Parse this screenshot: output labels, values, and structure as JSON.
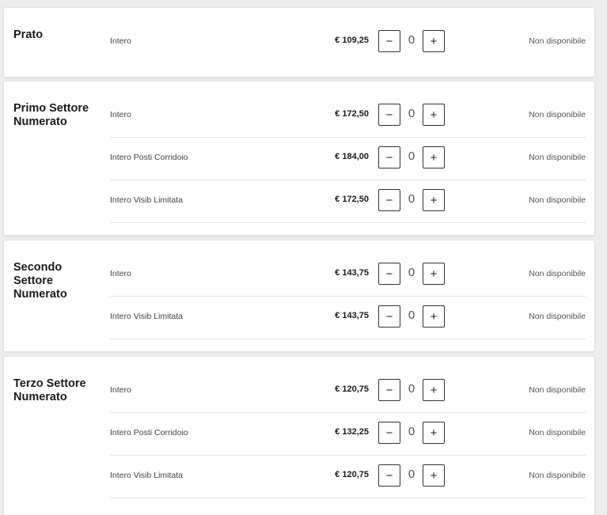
{
  "sectors": [
    {
      "name": "Prato",
      "tickets": [
        {
          "label": "Intero",
          "price": "€ 109,25",
          "qty": "0",
          "status": "Non disponibile"
        }
      ]
    },
    {
      "name": "Primo Settore Numerato",
      "tickets": [
        {
          "label": "Intero",
          "price": "€ 172,50",
          "qty": "0",
          "status": "Non disponibile"
        },
        {
          "label": "Intero Posti Corridoio",
          "price": "€ 184,00",
          "qty": "0",
          "status": "Non disponibile"
        },
        {
          "label": "Intero Visib Limitata",
          "price": "€ 172,50",
          "qty": "0",
          "status": "Non disponibile"
        }
      ]
    },
    {
      "name": "Secondo Settore Numerato",
      "tickets": [
        {
          "label": "Intero",
          "price": "€ 143,75",
          "qty": "0",
          "status": "Non disponibile"
        },
        {
          "label": "Intero Visib Limitata",
          "price": "€ 143,75",
          "qty": "0",
          "status": "Non disponibile"
        }
      ]
    },
    {
      "name": "Terzo Settore Numerato",
      "tickets": [
        {
          "label": "Intero",
          "price": "€ 120,75",
          "qty": "0",
          "status": "Non disponibile"
        },
        {
          "label": "Intero Posti Corridoio",
          "price": "€ 132,25",
          "qty": "0",
          "status": "Non disponibile"
        },
        {
          "label": "Intero Visib Limitata",
          "price": "€ 120,75",
          "qty": "0",
          "status": "Non disponibile"
        }
      ]
    }
  ],
  "buttons": {
    "minus": "−",
    "plus": "+"
  }
}
